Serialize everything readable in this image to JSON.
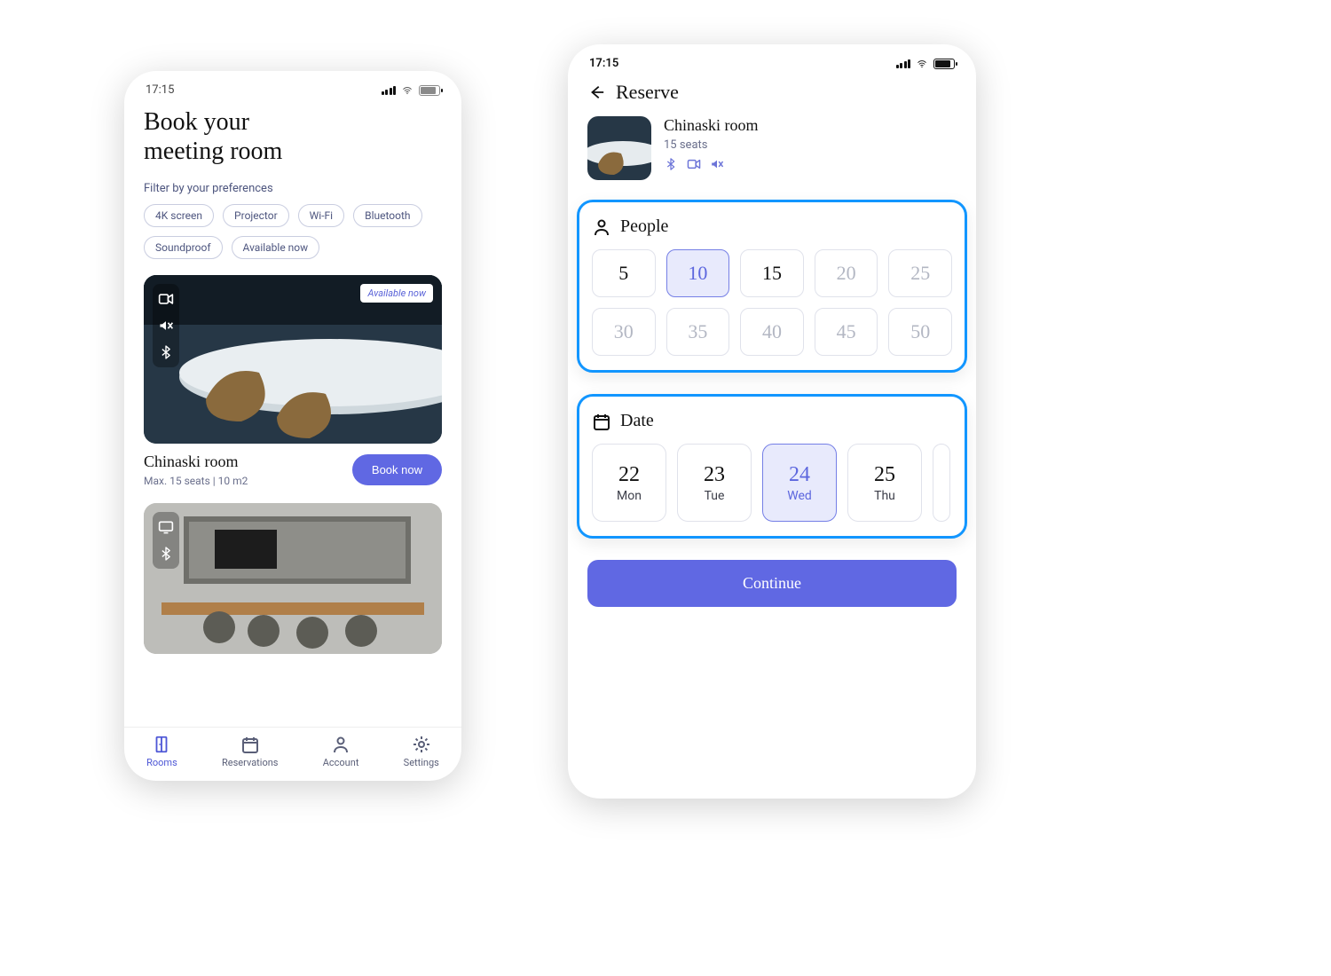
{
  "status_time": "17:15",
  "phone_a": {
    "title_line1": "Book your",
    "title_line2": "meeting room",
    "filter_header": "Filter by your preferences",
    "filters": [
      "4K screen",
      "Projector",
      "Wi-Fi",
      "Bluetooth",
      "Soundproof",
      "Available now"
    ],
    "rooms": [
      {
        "name": "Chinaski room",
        "meta": "Max. 15 seats   |   10 m2",
        "available_tag": "Available now",
        "book_label": "Book now",
        "feature_icons": [
          "video-icon",
          "mute-icon",
          "bluetooth-icon"
        ]
      },
      {
        "feature_icons": [
          "screen-icon",
          "bluetooth-icon"
        ]
      }
    ],
    "nav": [
      {
        "label": "Rooms",
        "active": true
      },
      {
        "label": "Reservations",
        "active": false
      },
      {
        "label": "Account",
        "active": false
      },
      {
        "label": "Settings",
        "active": false
      }
    ]
  },
  "phone_b": {
    "screen_title": "Reserve",
    "room": {
      "name": "Chinaski room",
      "seats": "15 seats",
      "feature_icons": [
        "bluetooth-icon",
        "video-icon",
        "mute-icon"
      ]
    },
    "people": {
      "heading": "People",
      "options": [
        {
          "v": "5",
          "state": "on"
        },
        {
          "v": "10",
          "state": "sel"
        },
        {
          "v": "15",
          "state": "on"
        },
        {
          "v": "20",
          "state": "dis"
        },
        {
          "v": "25",
          "state": "dis"
        },
        {
          "v": "30",
          "state": "dis"
        },
        {
          "v": "35",
          "state": "dis"
        },
        {
          "v": "40",
          "state": "dis"
        },
        {
          "v": "45",
          "state": "dis"
        },
        {
          "v": "50",
          "state": "dis"
        }
      ]
    },
    "date": {
      "heading": "Date",
      "options": [
        {
          "n": "22",
          "d": "Mon",
          "sel": false
        },
        {
          "n": "23",
          "d": "Tue",
          "sel": false
        },
        {
          "n": "24",
          "d": "Wed",
          "sel": true
        },
        {
          "n": "25",
          "d": "Thu",
          "sel": false
        }
      ]
    },
    "continue_label": "Continue"
  }
}
